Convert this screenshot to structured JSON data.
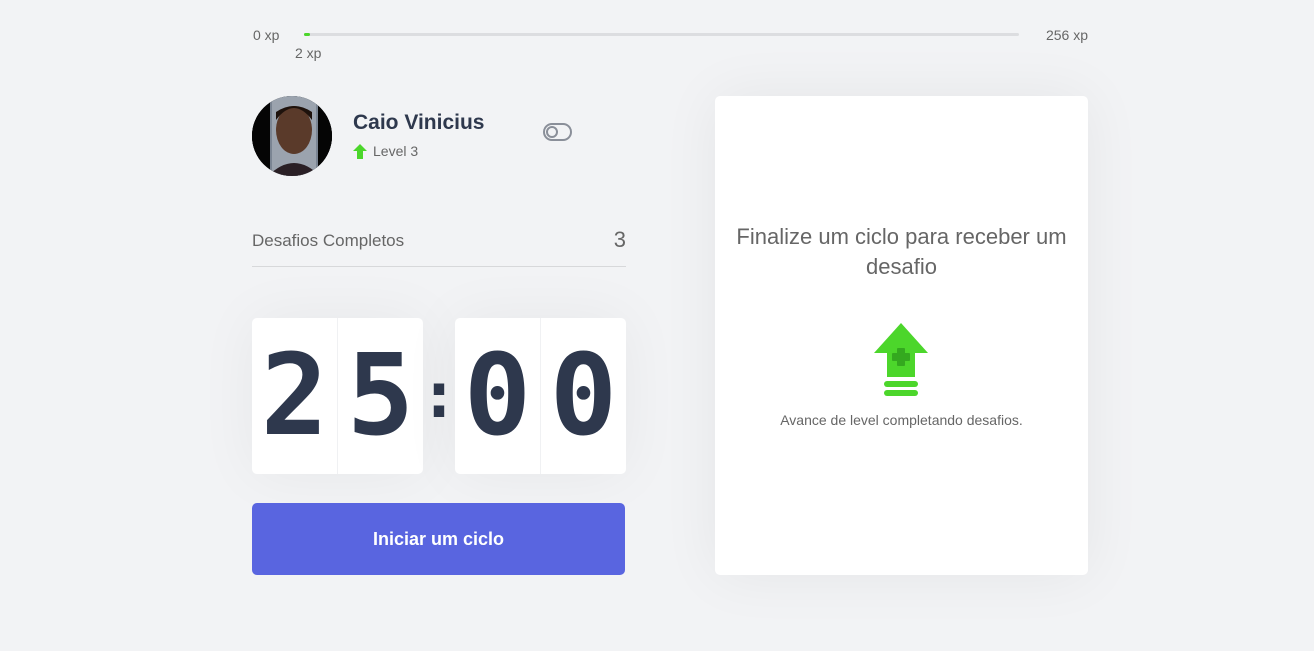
{
  "xp": {
    "min_label": "0 xp",
    "max_label": "256 xp",
    "current_label": "2 xp",
    "progress_percent": 0.8,
    "accent_color": "#4CD62B"
  },
  "profile": {
    "name": "Caio Vinicius",
    "level_label": "Level 3",
    "level_icon": "level-up-arrow-icon",
    "theme_toggle_icon": "toggle-icon"
  },
  "completed": {
    "label": "Desafios Completos",
    "count": "3"
  },
  "countdown": {
    "minute_left": "2",
    "minute_right": "5",
    "separator": ":",
    "second_left": "0",
    "second_right": "0"
  },
  "start_button": {
    "label": "Iniciar um ciclo",
    "color": "#5965E0"
  },
  "challenge": {
    "title": "Finalize um ciclo para receber um desafio",
    "hint": "Avance de level completando desafios.",
    "icon": "level-up-icon"
  }
}
